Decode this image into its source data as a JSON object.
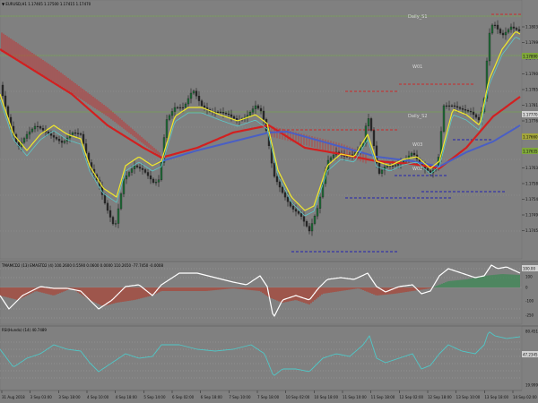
{
  "main_panel": {
    "title": "▼ EURUSD,H1  1.17465 1.17500 1.17415 1.17470",
    "annotations": [
      "Daily_S1",
      "W01",
      "Daily_S2",
      "W03",
      "W02"
    ],
    "price_ticks": [
      "1.18035",
      "1.17990",
      "1.17945",
      "1.17900",
      "1.17855",
      "1.17810",
      "1.17765",
      "1.17720",
      "1.17675",
      "1.17630",
      "1.17585",
      "1.17540",
      "1.17495",
      "1.17450"
    ],
    "highlight_labels": [
      {
        "text": "1.17890",
        "color": "#7fa73a"
      },
      {
        "text": "1.17770",
        "color": "#d0d0d0"
      },
      {
        "text": "1.17660",
        "color": "#a4a63a"
      },
      {
        "text": "1.17635",
        "color": "#7fa73a"
      }
    ]
  },
  "osc_panel": {
    "title": "TMAMCD2 (13) EMASTD2 (4)  100.2600 0.5590 0.0600 0.0000 110.2650 -77.7450 -0.0008",
    "ticks": [
      "200.00",
      "100",
      "0",
      "-100",
      "-250"
    ],
    "current_label": {
      "text": "100.00",
      "color": "#d0d0d0"
    }
  },
  "rsi_panel": {
    "title": "RSI(Hundo) (14)  40.7489",
    "ticks": [
      "80.4512",
      "47.2345",
      "19.9999"
    ],
    "current_label": {
      "text": "47.2345",
      "color": "#d0d0d0"
    }
  },
  "time_axis": [
    "31 Aug 2018",
    "3 Sep 03:00",
    "3 Sep 18:00",
    "4 Sep 10:00",
    "4 Sep 18:00",
    "5 Sep 14:00",
    "6 Sep 02:00",
    "6 Sep 18:00",
    "7 Sep 10:00",
    "7 Sep 18:00",
    "10 Sep 02:00",
    "10 Sep 18:00",
    "11 Sep 10:00",
    "11 Sep 18:00",
    "12 Sep 02:00",
    "12 Sep 18:00",
    "13 Sep 10:00",
    "13 Sep 18:00",
    "14 Sep 02:00"
  ],
  "colors": {
    "background": "#808080",
    "grid": "#9a9a9a",
    "bull": "#1f6b37",
    "bear": "#2a2a2a",
    "ma_red": "#d22020",
    "ma_blue": "#4a5fc4",
    "ma_yellow": "#f2ea2a",
    "ma_cyan": "#5cc8c8",
    "level_red": "#cc2a2a",
    "level_blue": "#2222b0",
    "hist_red": "#b23a2a",
    "hist_green": "#2c8a4a",
    "tma_white": "#ffffff",
    "rsi_line": "#4fc7c7"
  }
}
